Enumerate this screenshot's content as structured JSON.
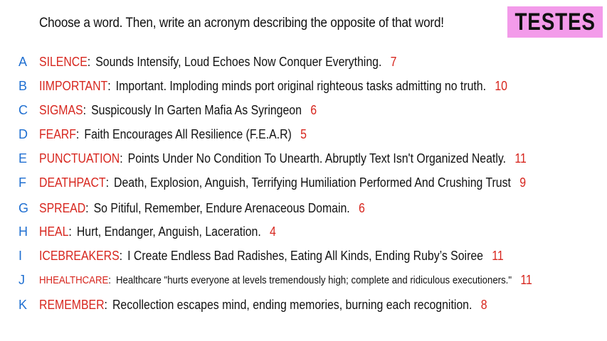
{
  "prompt": "Choose a word. Then, write an acronym describing the opposite of that word!",
  "badge": "TESTES",
  "colors": {
    "letter": "#1f6fd1",
    "word": "#d7261e",
    "badge_bg": "#f39bea"
  },
  "rows": [
    {
      "letter": "A",
      "word": "SILENCE",
      "acronym": "Sounds Intensify, Loud Echoes Now Conquer Everything.",
      "count": "7"
    },
    {
      "letter": "B",
      "word": "IIMPORTANT",
      "acronym": "Important. Imploding minds port original righteous tasks admitting no truth.",
      "count": "10"
    },
    {
      "letter": "C",
      "word": "SIGMAS",
      "acronym": "Suspicously In Garten Mafia As Syringeon",
      "count": "6"
    },
    {
      "letter": "D",
      "word": "FEARF",
      "acronym": "Faith Encourages All Resilience (F.E.A.R)",
      "count": "5"
    },
    {
      "letter": "E",
      "word": "PUNCTUATION",
      "acronym": "Points Under No Condition To Unearth. Abruptly Text Isn't Organized Neatly.",
      "count": "11"
    },
    {
      "letter": "F",
      "word": "DEATHPACT",
      "acronym": "Death, Explosion, Anguish, Terrifying Humiliation Performed And Crushing Trust",
      "count": "9"
    },
    {
      "letter": "G",
      "word": "SPREAD",
      "acronym": "So Pitiful, Remember, Endure Arenaceous Domain.",
      "count": "6"
    },
    {
      "letter": "H",
      "word": "HEAL",
      "acronym": "Hurt, Endanger, Anguish, Laceration.",
      "count": "4"
    },
    {
      "letter": "I",
      "word": "ICEBREAKERS",
      "acronym": "I Create Endless Bad Radishes, Eating All Kinds, Ending Ruby’s Soiree",
      "count": "11"
    },
    {
      "letter": "J",
      "word": "HHEALTHCARE",
      "acronym": "Healthcare \"hurts everyone at levels tremendously high; complete and ridiculous executioners.\"",
      "count": "11"
    },
    {
      "letter": "K",
      "word": "REMEMBER",
      "acronym": "Recollection escapes mind, ending memories, burning each recognition.",
      "count": "8"
    }
  ]
}
